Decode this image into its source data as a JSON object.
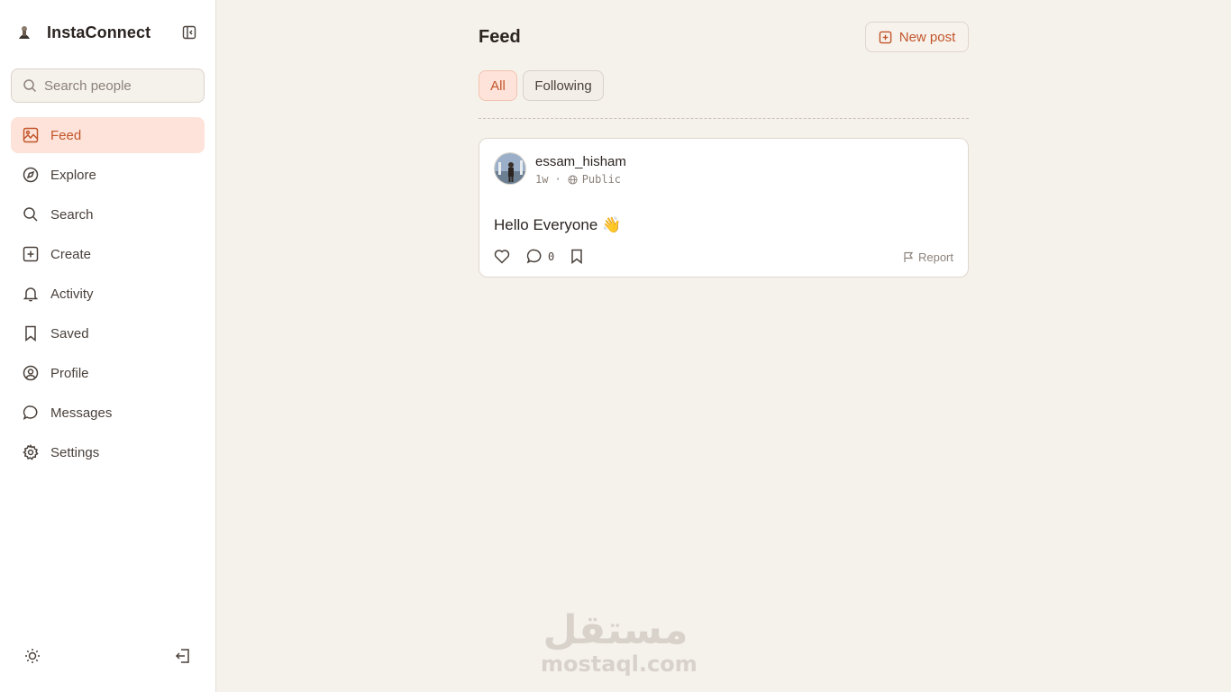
{
  "app": {
    "title": "InstaConnect"
  },
  "sidebar": {
    "search_placeholder": "Search people",
    "items": [
      {
        "label": "Feed",
        "icon": "image-icon",
        "active": true
      },
      {
        "label": "Explore",
        "icon": "compass-icon"
      },
      {
        "label": "Search",
        "icon": "search-icon"
      },
      {
        "label": "Create",
        "icon": "plus-square-icon"
      },
      {
        "label": "Activity",
        "icon": "bell-icon"
      },
      {
        "label": "Saved",
        "icon": "bookmark-icon"
      },
      {
        "label": "Profile",
        "icon": "user-circle-icon"
      },
      {
        "label": "Messages",
        "icon": "message-circle-icon"
      },
      {
        "label": "Settings",
        "icon": "gear-icon"
      }
    ],
    "bottom": {
      "theme_icon": "sun-icon",
      "logout_icon": "logout-icon"
    }
  },
  "main": {
    "title": "Feed",
    "new_post_label": "New post",
    "tabs": [
      {
        "label": "All",
        "active": true
      },
      {
        "label": "Following",
        "active": false
      }
    ],
    "posts": [
      {
        "username": "essam_hisham",
        "time": "1w",
        "separator": "·",
        "visibility": "Public",
        "text": "Hello Everyone 👋",
        "comment_count": "0",
        "report_label": "Report"
      }
    ]
  },
  "watermark": {
    "arabic": "مستقل",
    "latin": "mostaql.com"
  },
  "colors": {
    "accent": "#c2552b",
    "accent_bg": "#fde3d9",
    "page_bg": "#f5f1eb"
  }
}
